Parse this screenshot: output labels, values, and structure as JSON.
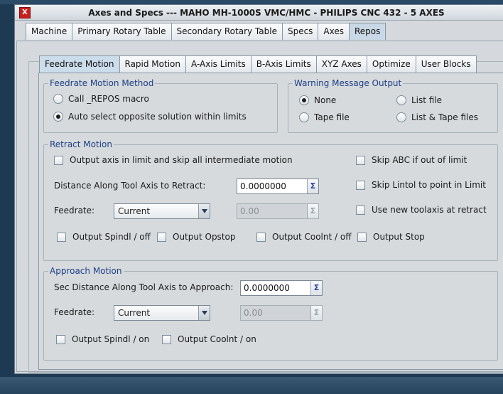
{
  "window": {
    "icon_text": "X",
    "title": "Axes and Specs --- MAHO MH-1000S VMC/HMC - PHILIPS CNC 432 - 5 AXES"
  },
  "top_tabs": [
    "Machine",
    "Primary Rotary Table",
    "Secondary Rotary Table",
    "Specs",
    "Axes",
    "Repos"
  ],
  "top_tabs_active": "Repos",
  "sub_tabs": [
    "Feedrate Motion",
    "Rapid Motion",
    "A-Axis Limits",
    "B-Axis Limits",
    "XYZ Axes",
    "Optimize",
    "User Blocks"
  ],
  "sub_tabs_active": "Feedrate Motion",
  "feedrate_method": {
    "title": "Feedrate Motion Method",
    "options": [
      {
        "label": "Call _REPOS macro",
        "selected": false
      },
      {
        "label": "Auto select opposite solution within limits",
        "selected": true
      }
    ]
  },
  "warning_output": {
    "title": "Warning Message Output",
    "options": [
      {
        "label": "None",
        "selected": true
      },
      {
        "label": "List file",
        "selected": false
      },
      {
        "label": "Tape file",
        "selected": false
      },
      {
        "label": "List & Tape files",
        "selected": false
      }
    ]
  },
  "retract": {
    "title": "Retract Motion",
    "output_axis_label": "Output axis in limit and skip all intermediate motion",
    "distance_label": "Distance Along Tool Axis to Retract:",
    "distance_value": "0.0000000",
    "feedrate_label": "Feedrate:",
    "feedrate_option": "Current",
    "feedrate_value": "0.00",
    "skip_abc_label": "Skip ABC if out of limit",
    "skip_lintol_label": "Skip Lintol to point in Limit",
    "new_toolaxis_label": "Use new toolaxis at retract",
    "spindl_off_label": "Output Spindl / off",
    "opstop_label": "Output Opstop",
    "coolnt_off_label": "Output Coolnt / off",
    "stop_label": "Output Stop"
  },
  "approach": {
    "title": "Approach Motion",
    "distance_label": "Sec Distance Along Tool Axis to Approach:",
    "distance_value": "0.0000000",
    "feedrate_label": "Feedrate:",
    "feedrate_option": "Current",
    "feedrate_value": "0.00",
    "spindl_on_label": "Output Spindl / on",
    "coolnt_on_label": "Output Coolnt / on"
  },
  "icons": {
    "sigma": "Σ"
  }
}
